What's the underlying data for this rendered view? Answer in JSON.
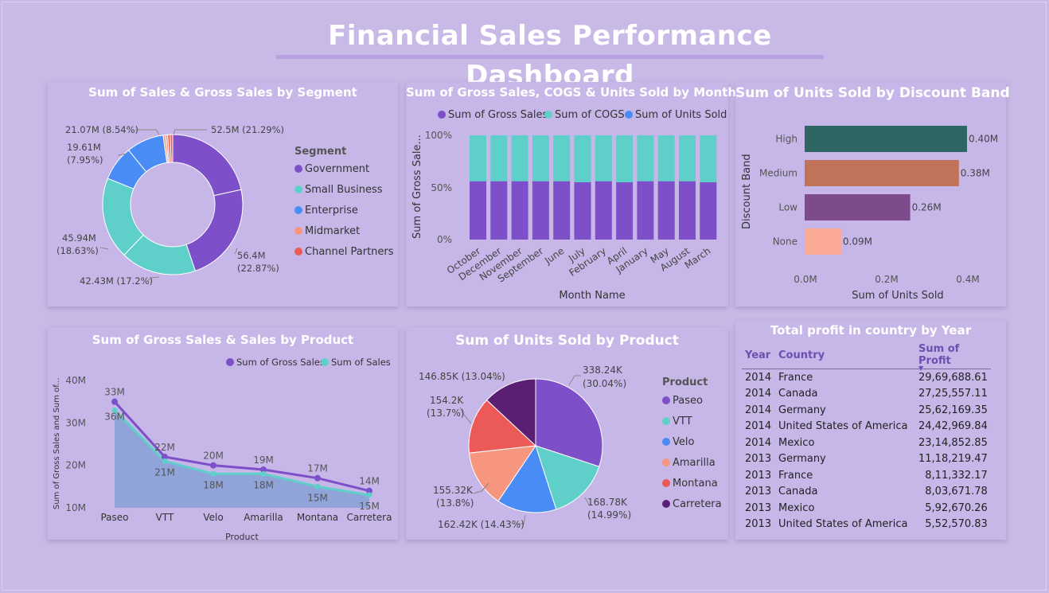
{
  "dashboard": {
    "title": "Financial Sales  Performance Dashboard"
  },
  "colors": {
    "purple": "#7d4fc9",
    "teal": "#5ecfc9",
    "blue": "#4a8cf5",
    "salmon": "#f7967f",
    "red": "#ec5a57",
    "dark": "#5a1f72",
    "high": "#2d6662",
    "medium": "#c07359",
    "low": "#7d4a8c",
    "none": "#fbaa95",
    "area": "#8aa2d8"
  },
  "segment_donut": {
    "title": "Sum of Sales & Gross Sales by Segment",
    "legend_title": "Segment",
    "legend": [
      "Government",
      "Small Business",
      "Enterprise",
      "Midmarket",
      "Channel Partners"
    ],
    "labels": {
      "government": "52.5M (21.29%)",
      "gov2": "56.4M",
      "gov2_pct": "(22.87%)",
      "smallbiz": "42.43M (17.2%)",
      "smallbiz2": "45.94M",
      "smallbiz2_pct": "(18.63%)",
      "enterprise": "19.61M",
      "enterprise_pct": "(7.95%)",
      "enterprise2": "21.07M (8.54%)"
    },
    "chart_data": {
      "type": "pie",
      "series": [
        {
          "name": "Government",
          "values": [
            52.5,
            56.4
          ]
        },
        {
          "name": "Small Business",
          "values": [
            42.43,
            45.94
          ]
        },
        {
          "name": "Enterprise",
          "values": [
            19.61,
            21.07
          ]
        },
        {
          "name": "Midmarket",
          "values": [
            1.2,
            1.3
          ]
        },
        {
          "name": "Channel Partners",
          "values": [
            1.4,
            1.5
          ]
        }
      ]
    }
  },
  "months_chart": {
    "title": "Sum of Gross Sales, COGS & Units Sold by Months",
    "legend": [
      "Sum of Gross Sales",
      "Sum of COGS",
      "Sum of Units Sold"
    ],
    "ylabel": "Sum of Gross Sale...",
    "xlabel": "Month Name",
    "yticks": [
      "100%",
      "50%",
      "0%"
    ],
    "chart_data": {
      "type": "bar",
      "categories": [
        "October",
        "December",
        "November",
        "September",
        "June",
        "July",
        "February",
        "April",
        "January",
        "May",
        "August",
        "March"
      ],
      "series": [
        {
          "name": "Sum of Gross Sales",
          "values": [
            56,
            56,
            56,
            56,
            56,
            55,
            56,
            55,
            56,
            56,
            56,
            55
          ]
        },
        {
          "name": "Sum of COGS",
          "values": [
            44,
            44,
            44,
            44,
            44,
            45,
            44,
            45,
            44,
            44,
            44,
            45
          ]
        }
      ],
      "ylim": [
        0,
        100
      ]
    }
  },
  "discount_chart": {
    "title": "Sum of Units Sold by Discount Band",
    "ylabel": "Discount Band",
    "xlabel": "Sum of Units Sold",
    "xticks": [
      "0.0M",
      "0.2M",
      "0.4M"
    ],
    "chart_data": {
      "type": "bar",
      "categories": [
        "High",
        "Medium",
        "Low",
        "None"
      ],
      "values": [
        0.4,
        0.38,
        0.26,
        0.09
      ],
      "value_labels": [
        "0.40M",
        "0.38M",
        "0.26M",
        "0.09M"
      ],
      "xlim": [
        0,
        0.4
      ]
    }
  },
  "product_line": {
    "title": "Sum of Gross Sales & Sales by Product",
    "legend": [
      "Sum of Gross Sales",
      "Sum of  Sales"
    ],
    "ylabel": "Sum of Gross Sales and Sum of...",
    "xlabel": "Product",
    "yticks": [
      "40M",
      "30M",
      "20M",
      "10M"
    ],
    "chart_data": {
      "type": "line",
      "categories": [
        "Paseo",
        "VTT",
        "Velo",
        "Amarilla",
        "Montana",
        "Carretera"
      ],
      "series": [
        {
          "name": "Sum of Gross Sales",
          "values": [
            35,
            22,
            20,
            19,
            17,
            14
          ],
          "labels": [
            "33M",
            "22M",
            "20M",
            "19M",
            "17M",
            "14M"
          ]
        },
        {
          "name": "Sum of  Sales",
          "values": [
            33,
            21,
            18,
            18,
            15,
            13
          ],
          "labels": [
            "36M",
            "21M",
            "18M",
            "18M",
            "15M",
            "15M"
          ]
        }
      ],
      "ylim": [
        10,
        40
      ]
    }
  },
  "units_pie": {
    "title": "Sum of Units Sold by Product",
    "legend_title": "Product",
    "legend": [
      "Paseo",
      "VTT",
      "Velo",
      "Amarilla",
      "Montana",
      "Carretera"
    ],
    "labels": [
      [
        "338.24K",
        "(30.04%)"
      ],
      [
        "168.78K",
        "(14.99%)"
      ],
      [
        "162.42K (14.43%)"
      ],
      [
        "155.32K",
        "(13.8%)"
      ],
      [
        "154.2K",
        "(13.7%)"
      ],
      [
        "146.85K (13.04%)"
      ]
    ],
    "chart_data": {
      "type": "pie",
      "categories": [
        "Paseo",
        "VTT",
        "Velo",
        "Amarilla",
        "Montana",
        "Carretera"
      ],
      "values": [
        338.24,
        168.78,
        162.42,
        155.32,
        154.2,
        146.85
      ]
    }
  },
  "profit_table": {
    "title": "Total profit in country by Year",
    "columns": [
      "Year",
      "Country",
      "Sum of Profit"
    ],
    "rows": [
      [
        "2014",
        "France",
        "29,69,688.61"
      ],
      [
        "2014",
        "Canada",
        "27,25,557.11"
      ],
      [
        "2014",
        "Germany",
        "25,62,169.35"
      ],
      [
        "2014",
        "United States of America",
        "24,42,969.84"
      ],
      [
        "2014",
        "Mexico",
        "23,14,852.85"
      ],
      [
        "2013",
        "Germany",
        "11,18,219.47"
      ],
      [
        "2013",
        "France",
        "8,11,332.17"
      ],
      [
        "2013",
        "Canada",
        "8,03,671.78"
      ],
      [
        "2013",
        "Mexico",
        "5,92,670.26"
      ],
      [
        "2013",
        "United States of America",
        "5,52,570.83"
      ]
    ]
  }
}
